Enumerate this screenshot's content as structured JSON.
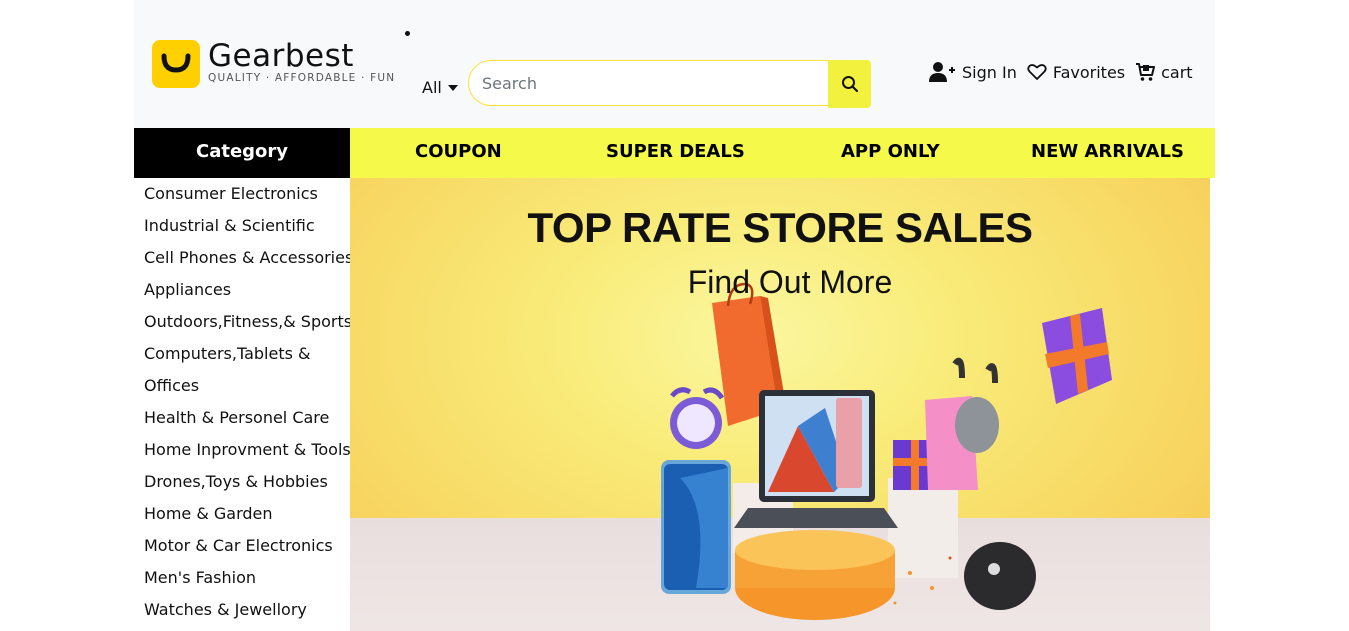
{
  "brand": {
    "name": "Gearbest",
    "tagline": "QUALITY · AFFORDABLE · FUN"
  },
  "search": {
    "scope": "All",
    "placeholder": "Search"
  },
  "account": {
    "sign_in": "Sign In",
    "favorites": "Favorites",
    "cart": "cart"
  },
  "nav": {
    "category": "Category",
    "links": [
      "COUPON",
      "SUPER DEALS",
      "APP ONLY",
      "NEW ARRIVALS"
    ]
  },
  "sidebar": {
    "items": [
      "Consumer Electronics",
      "Industrial & Scientific",
      "Cell Phones & Accessories",
      "Appliances",
      "Outdoors,Fitness,& Sports",
      "Computers,Tablets &",
      "Offices",
      "Health & Personel Care",
      "Home Inprovment & Tools",
      "Drones,Toys & Hobbies",
      "Home & Garden",
      "Motor & Car Electronics",
      "Men's Fashion",
      "Watches & Jewellory"
    ]
  },
  "banner": {
    "title": "TOP RATE STORE SALES",
    "subtitle": "Find Out More"
  },
  "colors": {
    "accent_yellow": "#f4f94a",
    "logo_yellow": "#ffd000",
    "category_bg": "#000000"
  },
  "icons": {
    "search": "search-icon",
    "sign_in": "user-plus-icon",
    "favorites": "heart-icon",
    "cart": "cart-icon",
    "dropdown": "caret-down-icon"
  }
}
